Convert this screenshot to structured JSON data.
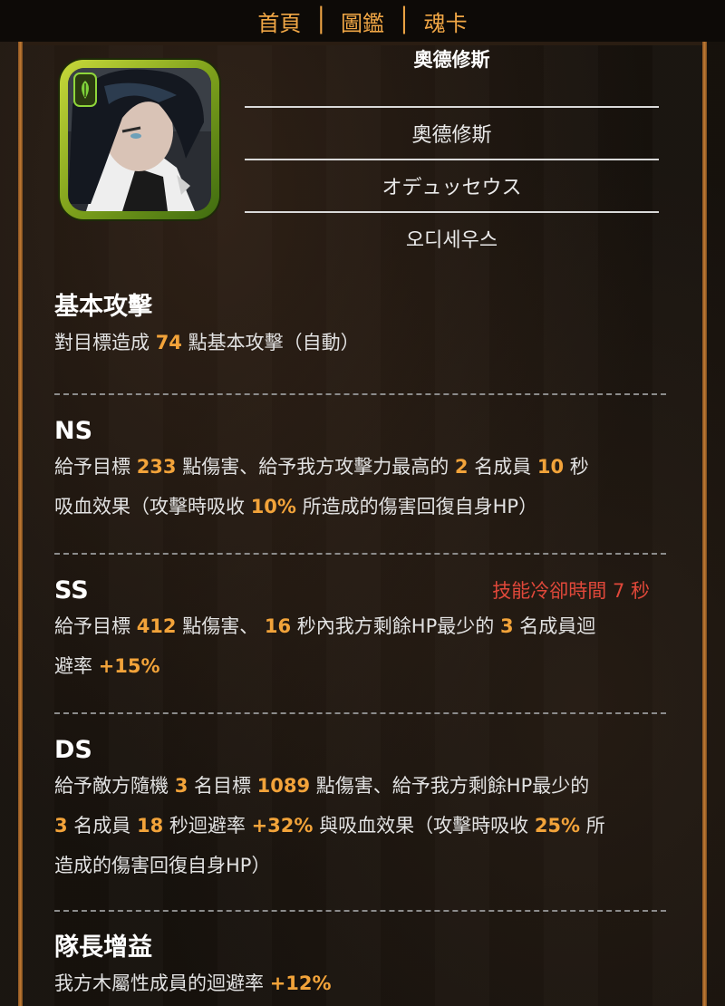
{
  "nav": {
    "home": "首頁",
    "catalog": "圖鑑",
    "soulcards": "魂卡"
  },
  "character": {
    "title": "奧德修斯",
    "names": [
      "奧德修斯",
      "オデュッセウス",
      "오디세우스"
    ],
    "attribute_icon": "leaf-icon",
    "frame_color": "#a6c12a"
  },
  "basic_attack": {
    "heading": "基本攻擊",
    "d1": "對目標造成 ",
    "n1": "74",
    "d2": " 點基本攻擊（自動）"
  },
  "ns": {
    "heading": "NS",
    "a1": "給予目標 ",
    "n1": "233",
    "a2": " 點傷害、給予我方攻擊力最高的 ",
    "n2": "2",
    "a3": " 名成員 ",
    "n3": "10",
    "a4": " 秒",
    "b1": "吸血效果（攻擊時吸收 ",
    "n4": "10%",
    "b2": " 所造成的傷害回復自身HP）"
  },
  "ss": {
    "heading": "SS",
    "cooldown": "技能冷卻時間 7 秒",
    "a1": "給予目標 ",
    "n1": "412",
    "a2": " 點傷害、 ",
    "n2": "16",
    "a3": " 秒內我方剩餘HP最少的 ",
    "n3": "3",
    "a4": " 名成員迴",
    "b1": "避率 ",
    "n4": "+15%"
  },
  "ds": {
    "heading": "DS",
    "a1": "給予敵方隨機 ",
    "n1": "3",
    "a2": " 名目標 ",
    "n2": "1089",
    "a3": " 點傷害、給予我方剩餘HP最少的",
    "b0": " ",
    "n3": "3",
    "b1": " 名成員 ",
    "n4": "18",
    "b2": " 秒迴避率 ",
    "n5": "+32%",
    "b3": " 與吸血效果（攻擊時吸收 ",
    "n6": "25%",
    "b4": " 所",
    "c1": "造成的傷害回復自身HP）"
  },
  "leader": {
    "heading": "隊長增益",
    "a1": "我方木屬性成員的迴避率 ",
    "n1": "+12%"
  },
  "colors": {
    "accent": "#f2a33a",
    "cooldown": "#e0483a",
    "nav": "#f0a645",
    "frame": "#c07a33"
  }
}
